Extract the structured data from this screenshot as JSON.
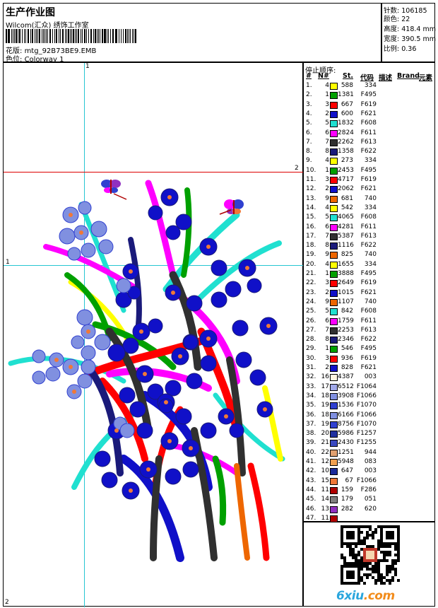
{
  "header": {
    "title": "生产作业图",
    "company": "Wilcom(汇众) 绣饰工作室",
    "design_label": "花版:",
    "design_value": "mtg_92B73BE9.EMB",
    "colorway_label": "色位:",
    "colorway_value": "Colorway 1"
  },
  "stats": [
    {
      "label": "针数:",
      "value": "106185"
    },
    {
      "label": "颜色:",
      "value": "22"
    },
    {
      "label": "高度:",
      "value": "418.4 mm"
    },
    {
      "label": "宽度:",
      "value": "390.5 mm"
    },
    {
      "label": "比例:",
      "value": "0.36"
    }
  ],
  "guides": {
    "v_label": "1",
    "h1_label": "1",
    "h2_label": "2",
    "corner_label": "2"
  },
  "stop_sequence": {
    "title": "停止顺序:",
    "columns": [
      "#",
      "N#",
      "St.",
      "代码",
      "描述",
      "Brand",
      "元素"
    ],
    "rows": [
      {
        "idx": "1.",
        "n": "4",
        "color": "#ffff00",
        "st": "588",
        "code": "334"
      },
      {
        "idx": "2.",
        "n": "1",
        "color": "#00a000",
        "st": "1381",
        "code": "F495"
      },
      {
        "idx": "3.",
        "n": "3",
        "color": "#ff0000",
        "st": "667",
        "code": "F619"
      },
      {
        "idx": "4.",
        "n": "2",
        "color": "#1010c8",
        "st": "600",
        "code": "F621"
      },
      {
        "idx": "5.",
        "n": "5",
        "color": "#20e0d0",
        "st": "1832",
        "code": "F608"
      },
      {
        "idx": "6.",
        "n": "6",
        "color": "#ff00ff",
        "st": "2824",
        "code": "F611"
      },
      {
        "idx": "7.",
        "n": "7",
        "color": "#303030",
        "st": "2262",
        "code": "F613"
      },
      {
        "idx": "8.",
        "n": "8",
        "color": "#1a1a7a",
        "st": "1358",
        "code": "F622"
      },
      {
        "idx": "9.",
        "n": "4",
        "color": "#ffff00",
        "st": "273",
        "code": "334"
      },
      {
        "idx": "10.",
        "n": "1",
        "color": "#00a000",
        "st": "2453",
        "code": "F495"
      },
      {
        "idx": "11.",
        "n": "3",
        "color": "#ff0000",
        "st": "4717",
        "code": "F619"
      },
      {
        "idx": "12.",
        "n": "2",
        "color": "#1010c8",
        "st": "2062",
        "code": "F621"
      },
      {
        "idx": "13.",
        "n": "9",
        "color": "#ee6600",
        "st": "681",
        "code": "740"
      },
      {
        "idx": "14.",
        "n": "4",
        "color": "#ffff00",
        "st": "542",
        "code": "334"
      },
      {
        "idx": "15.",
        "n": "5",
        "color": "#20e0d0",
        "st": "4065",
        "code": "F608"
      },
      {
        "idx": "16.",
        "n": "6",
        "color": "#ff00ff",
        "st": "4281",
        "code": "F611"
      },
      {
        "idx": "17.",
        "n": "7",
        "color": "#303030",
        "st": "5387",
        "code": "F613"
      },
      {
        "idx": "18.",
        "n": "8",
        "color": "#1a1a7a",
        "st": "1116",
        "code": "F622"
      },
      {
        "idx": "19.",
        "n": "9",
        "color": "#ee6600",
        "st": "825",
        "code": "740"
      },
      {
        "idx": "20.",
        "n": "4",
        "color": "#ffff00",
        "st": "1655",
        "code": "334"
      },
      {
        "idx": "21.",
        "n": "1",
        "color": "#00a000",
        "st": "3888",
        "code": "F495"
      },
      {
        "idx": "22.",
        "n": "3",
        "color": "#ff0000",
        "st": "2649",
        "code": "F619"
      },
      {
        "idx": "23.",
        "n": "2",
        "color": "#1010c8",
        "st": "1015",
        "code": "F621"
      },
      {
        "idx": "24.",
        "n": "9",
        "color": "#ee6600",
        "st": "1107",
        "code": "740"
      },
      {
        "idx": "25.",
        "n": "5",
        "color": "#20e0d0",
        "st": "842",
        "code": "F608"
      },
      {
        "idx": "26.",
        "n": "6",
        "color": "#ff00ff",
        "st": "1759",
        "code": "F611"
      },
      {
        "idx": "27.",
        "n": "7",
        "color": "#303030",
        "st": "2253",
        "code": "F613"
      },
      {
        "idx": "28.",
        "n": "8",
        "color": "#1a1a7a",
        "st": "2346",
        "code": "F622"
      },
      {
        "idx": "29.",
        "n": "1",
        "color": "#00a000",
        "st": "546",
        "code": "F495"
      },
      {
        "idx": "30.",
        "n": "3",
        "color": "#ff0000",
        "st": "936",
        "code": "F619"
      },
      {
        "idx": "31.",
        "n": "2",
        "color": "#1010c8",
        "st": "828",
        "code": "F621"
      },
      {
        "idx": "32.",
        "n": "16",
        "color": "#fff4e0",
        "st": "4387",
        "code": "003"
      },
      {
        "idx": "33.",
        "n": "17",
        "color": "#a0a8e8",
        "st": "6512",
        "code": "F1064"
      },
      {
        "idx": "34.",
        "n": "18",
        "color": "#8090e0",
        "st": "3908",
        "code": "F1066"
      },
      {
        "idx": "35.",
        "n": "19",
        "color": "#3040d0",
        "st": "1536",
        "code": "F1070"
      },
      {
        "idx": "36.",
        "n": "18",
        "color": "#8090e0",
        "st": "6166",
        "code": "F1066"
      },
      {
        "idx": "37.",
        "n": "19",
        "color": "#3040d0",
        "st": "8756",
        "code": "F1070"
      },
      {
        "idx": "38.",
        "n": "20",
        "color": "#2030a0",
        "st": "5986",
        "code": "F1257"
      },
      {
        "idx": "39.",
        "n": "21",
        "color": "#3848c0",
        "st": "2430",
        "code": "F1255"
      },
      {
        "idx": "40.",
        "n": "22",
        "color": "#e0a070",
        "st": "1251",
        "code": "944"
      },
      {
        "idx": "41.",
        "n": "12",
        "color": "#f0a050",
        "st": "5948",
        "code": "083"
      },
      {
        "idx": "42.",
        "n": "10",
        "color": "#1a2a9a",
        "st": "647",
        "code": "003"
      },
      {
        "idx": "43.",
        "n": "15",
        "color": "#f07838",
        "st": "67",
        "code": "F1066"
      },
      {
        "idx": "44.",
        "n": "11",
        "color": "#b00000",
        "st": "159",
        "code": "F286"
      },
      {
        "idx": "45.",
        "n": "14",
        "color": "#808080",
        "st": "179",
        "code": "051"
      },
      {
        "idx": "46.",
        "n": "13",
        "color": "#9030c0",
        "st": "282",
        "code": "620"
      },
      {
        "idx": "47.",
        "n": "11",
        "color": "#b00000",
        "st": "",
        "code": ""
      }
    ]
  },
  "footer": {
    "logo_main": "6xiu",
    "logo_tld": ".com"
  },
  "colors": {
    "guide_cyan": "#27c6d2",
    "guide_red": "#dd0000",
    "logo_blue": "#2aa6dd",
    "logo_orange": "#f28c1b"
  }
}
